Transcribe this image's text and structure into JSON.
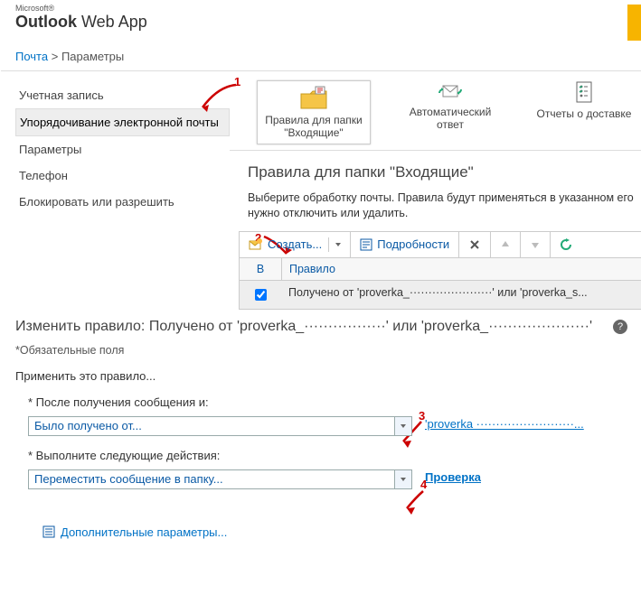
{
  "logo": {
    "ms": "Microsoft®",
    "app_bold": "Outlook",
    "app_rest": " Web App"
  },
  "breadcrumb": {
    "mail": "Почта",
    "sep": ">",
    "params": "Параметры"
  },
  "nav": {
    "items": [
      {
        "label": "Учетная запись"
      },
      {
        "label": "Упорядочивание электронной почты"
      },
      {
        "label": "Параметры"
      },
      {
        "label": "Телефон"
      },
      {
        "label": "Блокировать или разрешить"
      }
    ]
  },
  "ribbon": {
    "rules": "Правила для папки \"Входящие\"",
    "autoreply": "Автоматический ответ",
    "reports": "Отчеты о доставке"
  },
  "inbox_rules": {
    "title": "Правила для папки \"Входящие\"",
    "desc": "Выберите обработку почты. Правила будут применяться в указанном его нужно отключить или удалить.",
    "toolbar": {
      "create": "Создать...",
      "details": "Подробности"
    },
    "columns": {
      "c1": "В",
      "c2": "Правило"
    },
    "row": {
      "text": "Получено от 'proverka_······················' или 'proverka_s..."
    }
  },
  "annotations": {
    "n1": "1",
    "n2": "2",
    "n3": "3",
    "n4": "4"
  },
  "edit": {
    "title": "Изменить правило: Получено от 'proverka_·················' или 'proverka_·····················'",
    "required": "*Обязательные поля",
    "apply": "Применить это правило...",
    "after": "* После получения сообщения и:",
    "after_value": "Было получено от...",
    "after_link": "'proverka ·························...",
    "actions": "* Выполните следующие действия:",
    "actions_value": "Переместить сообщение в папку...",
    "actions_link": "Проверка",
    "advanced": "Дополнительные параметры..."
  }
}
